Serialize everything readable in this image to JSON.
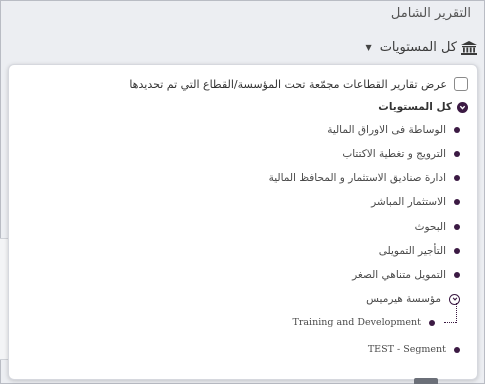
{
  "header": {
    "title": "التقرير الشامل"
  },
  "scope_selector": {
    "label": "كل المستويات",
    "icon": "bank-icon"
  },
  "panel": {
    "option_label": "عرض تقارير القطاعات مجمّعة تحت المؤسسة/القطاع التي تم تحديدها",
    "root_label": "كل المستويات",
    "items": [
      {
        "label": "الوساطة فى الاوراق المالية"
      },
      {
        "label": "الترويج و تغطية الاكتتاب"
      },
      {
        "label": "ادارة صناديق الاستثمار و المحافظ المالية"
      },
      {
        "label": "الاستثمار المباشر"
      },
      {
        "label": "البحوث"
      },
      {
        "label": "التأجير التمويلى"
      },
      {
        "label": "التمويل متناهي الصغر"
      },
      {
        "label": "مؤسسة هيرميس"
      },
      {
        "label": "TEST - Segment"
      }
    ],
    "children": [
      {
        "label": "Training and Development"
      }
    ]
  },
  "colors": {
    "accent": "#3b1a43"
  }
}
